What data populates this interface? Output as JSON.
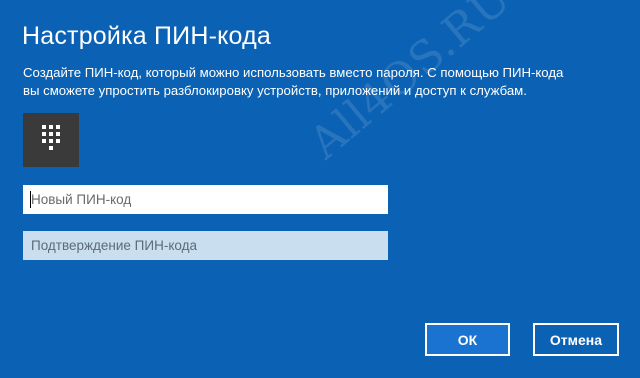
{
  "dialog": {
    "title": "Настройка ПИН-кода",
    "description_line1": "Создайте ПИН-код, который можно использовать вместо пароля. С помощью ПИН-кода",
    "description_line2": "вы сможете упростить разблокировку устройств, приложений и доступ к службам.",
    "icon": "pin-keypad-icon"
  },
  "fields": {
    "new_pin_placeholder": "Новый ПИН-код",
    "confirm_pin_placeholder": "Подтверждение ПИН-кода"
  },
  "buttons": {
    "ok_label": "ОК",
    "cancel_label": "Отмена"
  },
  "watermark": "All4OS.RU",
  "colors": {
    "background": "#0b62b4",
    "ok_button": "#1a73d0",
    "icon_tile": "#3a3a3a"
  }
}
